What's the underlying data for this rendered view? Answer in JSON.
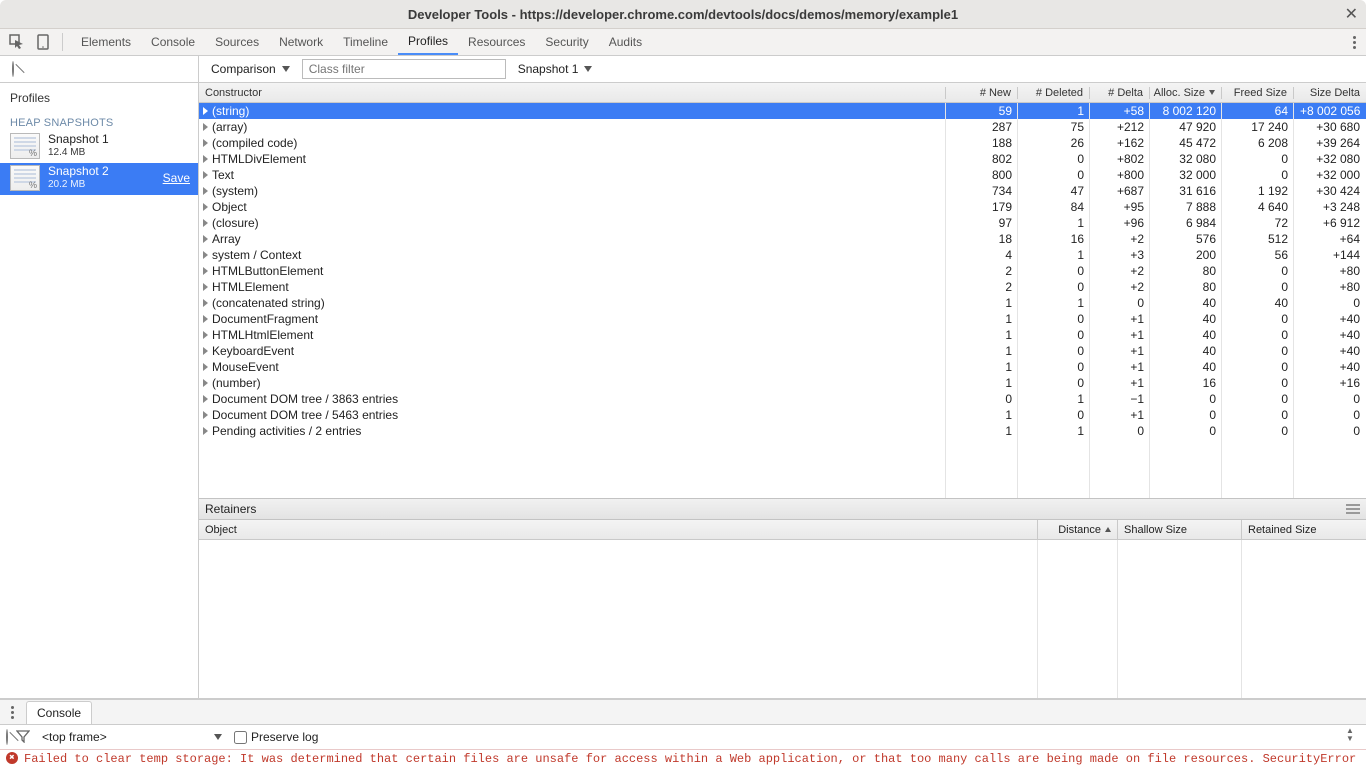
{
  "window": {
    "title": "Developer Tools - https://developer.chrome.com/devtools/docs/demos/memory/example1"
  },
  "tabs": {
    "items": [
      "Elements",
      "Console",
      "Sources",
      "Network",
      "Timeline",
      "Profiles",
      "Resources",
      "Security",
      "Audits"
    ],
    "active_index": 5
  },
  "sidebar": {
    "title": "Profiles",
    "heading": "HEAP SNAPSHOTS",
    "snapshots": [
      {
        "name": "Snapshot 1",
        "size": "12.4 MB",
        "selected": false,
        "save": ""
      },
      {
        "name": "Snapshot 2",
        "size": "20.2 MB",
        "selected": true,
        "save": "Save"
      }
    ]
  },
  "toolbar": {
    "view_mode": "Comparison",
    "class_filter_placeholder": "Class filter",
    "base_snapshot": "Snapshot 1"
  },
  "columns": {
    "ctor": "Constructor",
    "new": "# New",
    "deleted": "# Deleted",
    "delta": "# Delta",
    "alloc": "Alloc. Size",
    "freed": "Freed Size",
    "sizedelta": "Size Delta"
  },
  "rows": [
    {
      "ctor": "(string)",
      "new": "59",
      "deleted": "1",
      "delta": "+58",
      "alloc": "8 002 120",
      "freed": "64",
      "sizedelta": "+8 002 056",
      "selected": true
    },
    {
      "ctor": "(array)",
      "new": "287",
      "deleted": "75",
      "delta": "+212",
      "alloc": "47 920",
      "freed": "17 240",
      "sizedelta": "+30 680"
    },
    {
      "ctor": "(compiled code)",
      "new": "188",
      "deleted": "26",
      "delta": "+162",
      "alloc": "45 472",
      "freed": "6 208",
      "sizedelta": "+39 264"
    },
    {
      "ctor": "HTMLDivElement",
      "new": "802",
      "deleted": "0",
      "delta": "+802",
      "alloc": "32 080",
      "freed": "0",
      "sizedelta": "+32 080"
    },
    {
      "ctor": "Text",
      "new": "800",
      "deleted": "0",
      "delta": "+800",
      "alloc": "32 000",
      "freed": "0",
      "sizedelta": "+32 000"
    },
    {
      "ctor": "(system)",
      "new": "734",
      "deleted": "47",
      "delta": "+687",
      "alloc": "31 616",
      "freed": "1 192",
      "sizedelta": "+30 424"
    },
    {
      "ctor": "Object",
      "new": "179",
      "deleted": "84",
      "delta": "+95",
      "alloc": "7 888",
      "freed": "4 640",
      "sizedelta": "+3 248"
    },
    {
      "ctor": "(closure)",
      "new": "97",
      "deleted": "1",
      "delta": "+96",
      "alloc": "6 984",
      "freed": "72",
      "sizedelta": "+6 912"
    },
    {
      "ctor": "Array",
      "new": "18",
      "deleted": "16",
      "delta": "+2",
      "alloc": "576",
      "freed": "512",
      "sizedelta": "+64"
    },
    {
      "ctor": "system / Context",
      "new": "4",
      "deleted": "1",
      "delta": "+3",
      "alloc": "200",
      "freed": "56",
      "sizedelta": "+144"
    },
    {
      "ctor": "HTMLButtonElement",
      "new": "2",
      "deleted": "0",
      "delta": "+2",
      "alloc": "80",
      "freed": "0",
      "sizedelta": "+80"
    },
    {
      "ctor": "HTMLElement",
      "new": "2",
      "deleted": "0",
      "delta": "+2",
      "alloc": "80",
      "freed": "0",
      "sizedelta": "+80"
    },
    {
      "ctor": "(concatenated string)",
      "new": "1",
      "deleted": "1",
      "delta": "0",
      "alloc": "40",
      "freed": "40",
      "sizedelta": "0"
    },
    {
      "ctor": "DocumentFragment",
      "new": "1",
      "deleted": "0",
      "delta": "+1",
      "alloc": "40",
      "freed": "0",
      "sizedelta": "+40"
    },
    {
      "ctor": "HTMLHtmlElement",
      "new": "1",
      "deleted": "0",
      "delta": "+1",
      "alloc": "40",
      "freed": "0",
      "sizedelta": "+40"
    },
    {
      "ctor": "KeyboardEvent",
      "new": "1",
      "deleted": "0",
      "delta": "+1",
      "alloc": "40",
      "freed": "0",
      "sizedelta": "+40"
    },
    {
      "ctor": "MouseEvent",
      "new": "1",
      "deleted": "0",
      "delta": "+1",
      "alloc": "40",
      "freed": "0",
      "sizedelta": "+40"
    },
    {
      "ctor": "(number)",
      "new": "1",
      "deleted": "0",
      "delta": "+1",
      "alloc": "16",
      "freed": "0",
      "sizedelta": "+16"
    },
    {
      "ctor": "Document DOM tree / 3863 entries",
      "new": "0",
      "deleted": "1",
      "delta": "−1",
      "alloc": "0",
      "freed": "0",
      "sizedelta": "0"
    },
    {
      "ctor": "Document DOM tree / 5463 entries",
      "new": "1",
      "deleted": "0",
      "delta": "+1",
      "alloc": "0",
      "freed": "0",
      "sizedelta": "0"
    },
    {
      "ctor": "Pending activities / 2 entries",
      "new": "1",
      "deleted": "1",
      "delta": "0",
      "alloc": "0",
      "freed": "0",
      "sizedelta": "0"
    }
  ],
  "retainers": {
    "title": "Retainers",
    "columns": {
      "object": "Object",
      "distance": "Distance",
      "shallow": "Shallow Size",
      "retained": "Retained Size"
    }
  },
  "drawer": {
    "tab_label": "Console",
    "frame_selector": "<top frame>",
    "preserve_log_label": "Preserve log",
    "error": "Failed to clear temp storage: It was determined that certain files are unsafe for access within a Web application, or that too many calls are being made on file resources. SecurityError"
  }
}
